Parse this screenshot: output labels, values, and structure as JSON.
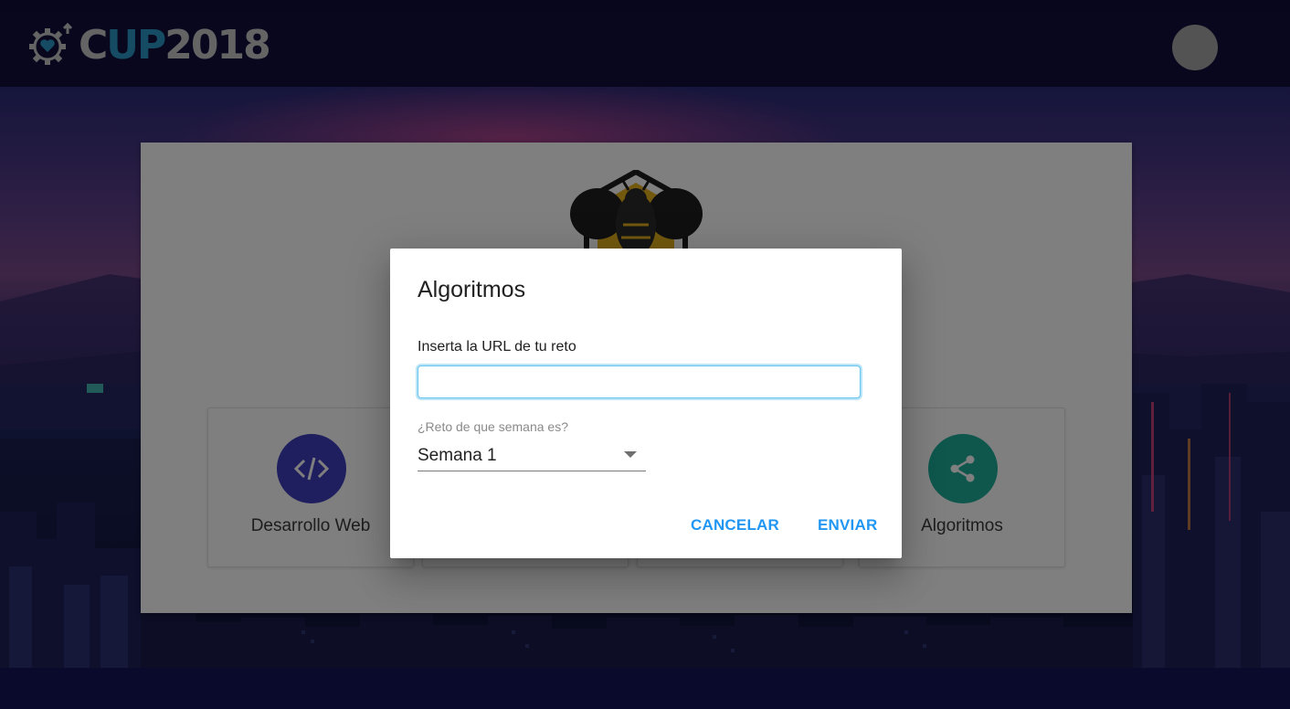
{
  "header": {
    "logo": {
      "text_c": "C",
      "text_up": "UP",
      "text_year": "2018"
    }
  },
  "categories": [
    {
      "label": "Desarrollo Web",
      "icon": "code-icon",
      "color": "#3f3fbf"
    },
    {
      "label": "",
      "icon": "",
      "color": ""
    },
    {
      "label": "",
      "icon": "",
      "color": ""
    },
    {
      "label": "Algoritmos",
      "icon": "share-icon",
      "color": "#1fae9b"
    }
  ],
  "dialog": {
    "title": "Algoritmos",
    "url_label": "Inserta la URL de tu reto",
    "url_value": "",
    "select_label": "¿Reto de que semana es?",
    "select_value": "Semana 1",
    "cancel_label": "CANCELAR",
    "send_label": "ENVIAR",
    "accent_color": "#2196f3"
  }
}
